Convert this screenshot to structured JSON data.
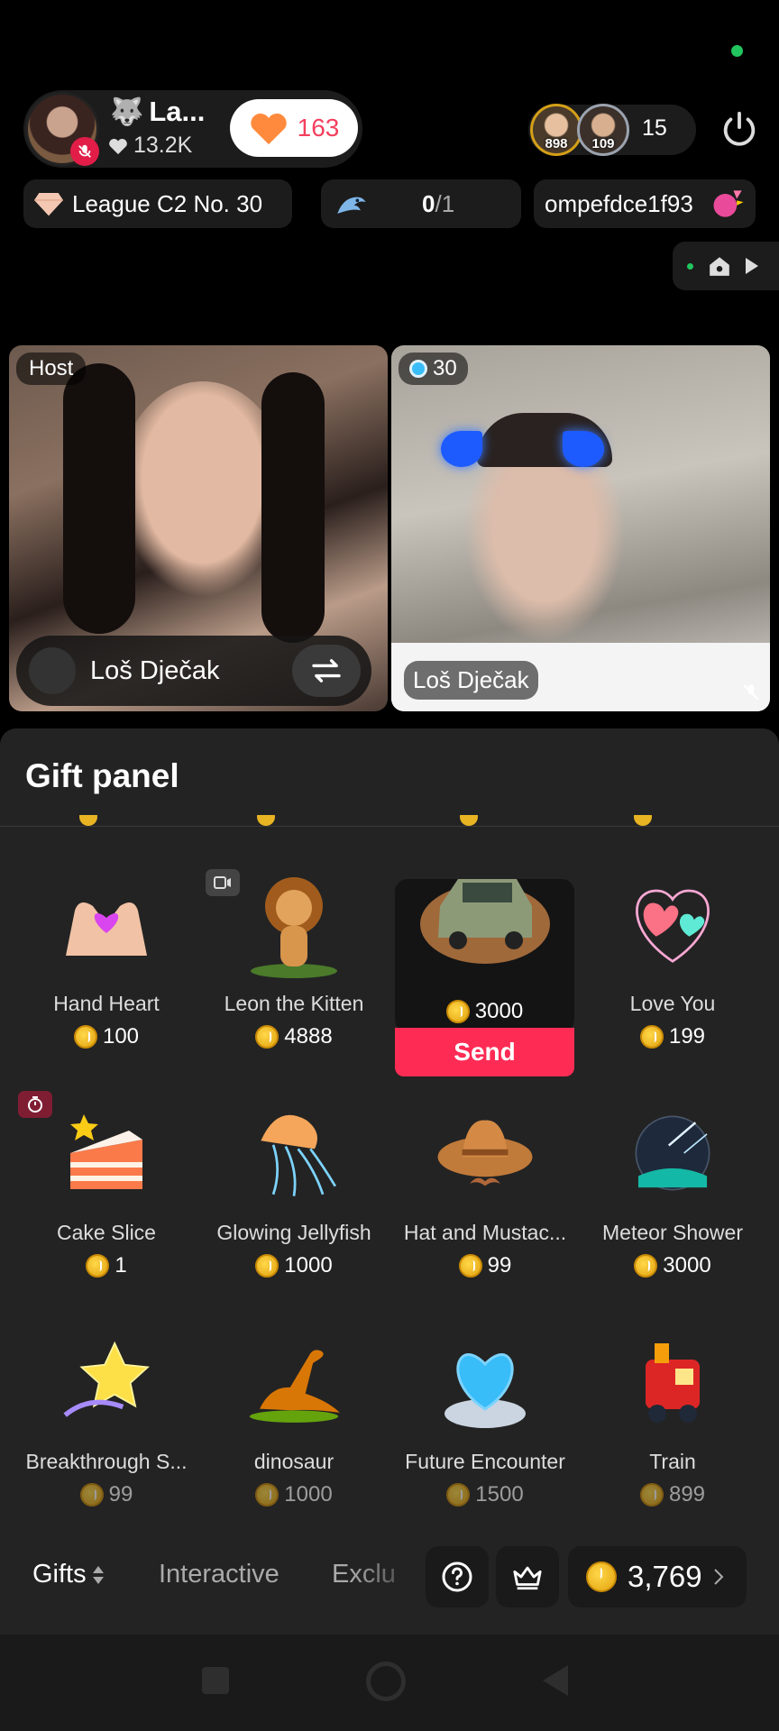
{
  "header": {
    "host_name": "La...",
    "host_likes": "13.2K",
    "like_count": "163",
    "viewer_ranks": [
      "898",
      "109"
    ],
    "viewer_count": "15",
    "league": "League C2 No. 30",
    "goal_current": "0",
    "goal_total": "/1",
    "user_handle": "ompefdce1f93"
  },
  "video": {
    "host_tag": "Host",
    "guest_score": "30",
    "host_name": "Loš Dječak",
    "guest_name": "Loš Dječak"
  },
  "panel": {
    "title": "Gift panel",
    "gifts": [
      {
        "name": "Hand Heart",
        "price": "100"
      },
      {
        "name": "Leon the Kitten",
        "price": "4888"
      },
      {
        "name": "",
        "price": "3000",
        "action": "Send"
      },
      {
        "name": "Love You",
        "price": "199"
      },
      {
        "name": "Cake Slice",
        "price": "1"
      },
      {
        "name": "Glowing Jellyfish",
        "price": "1000"
      },
      {
        "name": "Hat and Mustac...",
        "price": "99"
      },
      {
        "name": "Meteor Shower",
        "price": "3000"
      },
      {
        "name": "Breakthrough S...",
        "price": "99"
      },
      {
        "name": "dinosaur",
        "price": "1000"
      },
      {
        "name": "Future Encounter",
        "price": "1500"
      },
      {
        "name": "Train",
        "price": "899"
      }
    ]
  },
  "tabs": {
    "gifts": "Gifts",
    "interactive": "Interactive",
    "exclusive": "Exclu"
  },
  "balance": "3,769",
  "colors": {
    "accent": "#fe2c55",
    "coin": "#e8b423",
    "panel_bg": "#232323"
  }
}
